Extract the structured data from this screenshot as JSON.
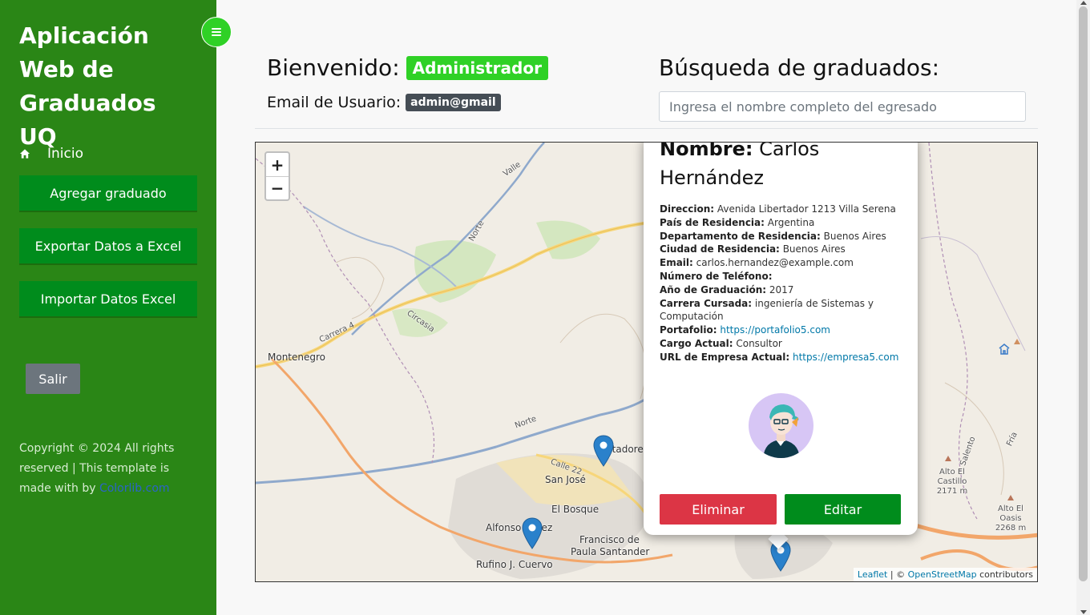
{
  "sidebar": {
    "brand": "Aplicación Web de Graduados UQ",
    "home_label": "Inicio",
    "buttons": [
      "Agregar graduado",
      "Exportar Datos a Excel",
      "Importar Datos Excel"
    ],
    "logout_label": "Salir",
    "copyright_text": "Copyright © 2024 All rights reserved | This template is made with by ",
    "copyright_link": "Colorlib.com"
  },
  "header": {
    "welcome_label": "Bienvenido:",
    "user_role": "Administrador",
    "email_label": "Email de Usuario:",
    "user_email": "admin@gmail",
    "search_title": "Búsqueda de graduados:",
    "search_placeholder": "Ingresa el nombre completo del egresado"
  },
  "map": {
    "zoom_in": "+",
    "zoom_out": "−",
    "places": {
      "montenegro": "Montenegro",
      "san_jose": "San José",
      "el_bosque": "El Bosque",
      "alfonso": "Alfonso López",
      "francisco": "Francisco de",
      "paula": "Paula Santander",
      "rufino": "Rufino J. Cuervo",
      "cortadores": "Cortadores",
      "circasia": "Circasia",
      "norte1": "Norte",
      "norte2": "Norte",
      "valle": "Valle",
      "carrera4": "Carrera 4",
      "calle22": "Calle 22",
      "salento": "Salento",
      "fria": "Fría",
      "alto_castillo": "Alto El Castillo",
      "alto_castillo_elev": "2171 m",
      "alto_oasis": "Alto El Oasis",
      "alto_oasis_elev": "2268 m"
    },
    "attribution": {
      "leaflet": "Leaflet",
      "sep": " | © ",
      "osm": "OpenStreetMap",
      "contributors": " contributors"
    }
  },
  "popup": {
    "name_label": "Nombre:",
    "name_value": "Carlos Hernández",
    "fields": [
      {
        "label": "Direccion:",
        "value": "Avenida Libertador 1213 Villa Serena"
      },
      {
        "label": "País de Residencia:",
        "value": "Argentina"
      },
      {
        "label": "Departamento de Residencia:",
        "value": "Buenos Aires"
      },
      {
        "label": "Ciudad de Residencia:",
        "value": "Buenos Aires"
      },
      {
        "label": "Email:",
        "value": "carlos.hernandez@example.com"
      },
      {
        "label": "Número de Teléfono:",
        "value": ""
      },
      {
        "label": "Año de Graduación:",
        "value": "2017"
      },
      {
        "label": "Carrera Cursada:",
        "value": "ingeniería de Sistemas y Computación"
      },
      {
        "label": "Portafolio:",
        "value": "https://portafolio5.com"
      },
      {
        "label": "Cargo Actual:",
        "value": "Consultor"
      },
      {
        "label": "URL de Empresa Actual:",
        "value": "https://empresa5.com"
      }
    ],
    "delete_label": "Eliminar",
    "edit_label": "Editar"
  },
  "colors": {
    "sidebar_bg": "#2a8616",
    "accent_green": "#2fd126",
    "button_green": "#008c1c",
    "danger": "#dc3545",
    "secondary": "#6c757d",
    "marker_blue": "#2a81cb"
  }
}
